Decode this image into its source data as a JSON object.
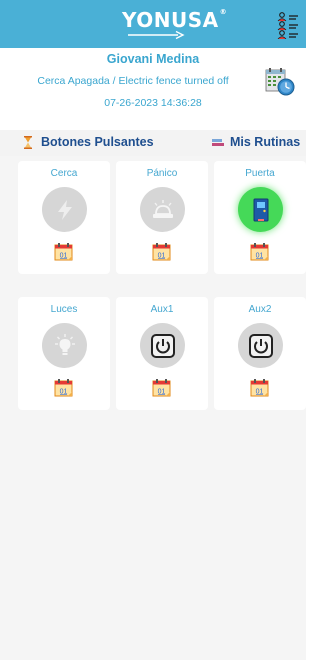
{
  "header": {
    "logo_text": "YONUSA",
    "logo_reg": "®",
    "users_icon": "users-list-icon",
    "color": "#4ab0d6"
  },
  "status": {
    "user_name": "Giovani Medina",
    "fence_status": "Cerca Apagada / Electric fence turned off",
    "timestamp": "07-26-2023 14:36:28",
    "icon": "calendar-clock-icon"
  },
  "tabs": {
    "buttons_label": "Botones Pulsantes",
    "buttons_icon": "hourglass-icon",
    "routines_label": "Mis Rutinas",
    "routines_icon": "bookmark-icon"
  },
  "cards": [
    {
      "label": "Cerca",
      "icon": "lightning-icon",
      "active": false,
      "calendar_text": "01"
    },
    {
      "label": "Pánico",
      "icon": "alarm-siren-icon",
      "active": false,
      "calendar_text": "01"
    },
    {
      "label": "Puerta",
      "icon": "door-icon",
      "active": true,
      "calendar_text": "01"
    },
    {
      "label": "Luces",
      "icon": "light-bulb-icon",
      "active": false,
      "calendar_text": "01"
    },
    {
      "label": "Aux1",
      "icon": "power-icon",
      "active": false,
      "calendar_text": "01"
    },
    {
      "label": "Aux2",
      "icon": "power-icon",
      "active": false,
      "calendar_text": "01"
    }
  ],
  "colors": {
    "accent": "#3aa6cf",
    "tab_text": "#1f4f8f",
    "active": "#45d958",
    "inactive": "#d6d6d6"
  }
}
